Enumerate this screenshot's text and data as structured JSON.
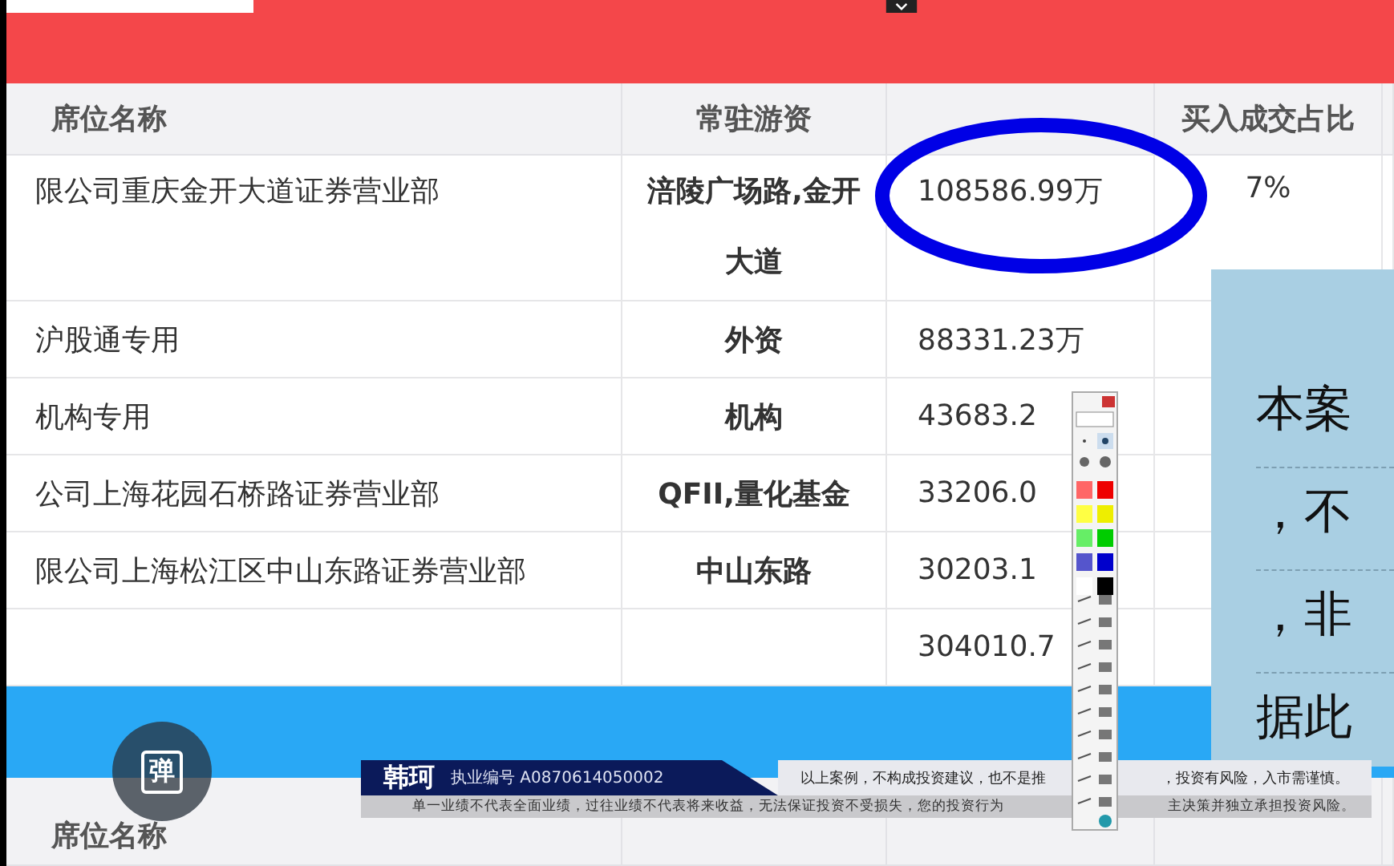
{
  "table": {
    "header": {
      "seat": "席位名称",
      "trader": "常驻游资",
      "ratio": "买入成交占比"
    },
    "rows": [
      {
        "seat": "限公司重庆金开大道证券营业部",
        "trader": "涪陵广场路,金开大道",
        "buy": "108586.99万",
        "ratio": "7%"
      },
      {
        "seat": "沪股通专用",
        "trader": "外资",
        "buy": "88331.23万"
      },
      {
        "seat": "机构专用",
        "trader": "机构",
        "buy": "43683.2"
      },
      {
        "seat": "公司上海花园石桥路证券营业部",
        "trader": "QFII,量化基金",
        "buy": "33206.0"
      },
      {
        "seat": "限公司上海松江区中山东路证券营业部",
        "trader": "中山东路",
        "buy": "30203.1"
      }
    ],
    "total": "304010.7"
  },
  "second_table": {
    "columns": [
      "席位名称"
    ]
  },
  "float_button": {
    "label": "弹"
  },
  "side_panel": {
    "lines": [
      "本案",
      "，不",
      "，非",
      "据此"
    ]
  },
  "banner": {
    "name": "韩珂",
    "license": "执业编号 A0870614050002",
    "notice_parts": [
      "以上案例，不构成投资建议，也不是推",
      "，投资有风险，入市需谨慎。"
    ],
    "disclaimer_parts": [
      "单一业绩不代表全面业绩，过往业绩不代表将来收益，无法保证投资不受损失，您的投资行为",
      "主决策并独立承担投资风险。"
    ]
  }
}
